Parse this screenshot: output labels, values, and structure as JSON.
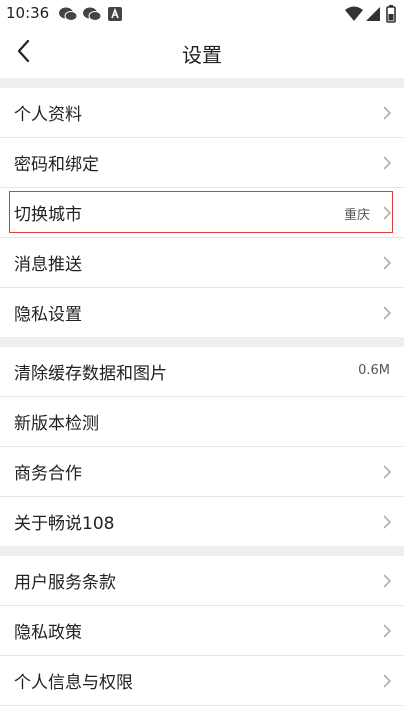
{
  "status_bar": {
    "time": "10:36",
    "notification_icons": [
      "wechat-icon",
      "wechat-icon",
      "app-a-icon"
    ],
    "right_icons": [
      "wifi-icon",
      "signal-icon",
      "battery-icon"
    ]
  },
  "header": {
    "title": "设置",
    "back_icon": "chevron-left-icon"
  },
  "sections": [
    {
      "items": [
        {
          "label": "个人资料",
          "value": "",
          "arrow": true
        },
        {
          "label": "密码和绑定",
          "value": "",
          "arrow": true
        },
        {
          "label": "切换城市",
          "value": "重庆",
          "arrow": true,
          "highlighted": true
        },
        {
          "label": "消息推送",
          "value": "",
          "arrow": true
        },
        {
          "label": "隐私设置",
          "value": "",
          "arrow": true
        }
      ]
    },
    {
      "items": [
        {
          "label": "清除缓存数据和图片",
          "value": "0.6M",
          "arrow": false
        },
        {
          "label": "新版本检测",
          "value": "",
          "arrow": false
        },
        {
          "label": "商务合作",
          "value": "",
          "arrow": true
        },
        {
          "label": "关于畅说108",
          "value": "",
          "arrow": true
        }
      ]
    },
    {
      "items": [
        {
          "label": "用户服务条款",
          "value": "",
          "arrow": true
        },
        {
          "label": "隐私政策",
          "value": "",
          "arrow": true
        },
        {
          "label": "个人信息与权限",
          "value": "",
          "arrow": true
        }
      ]
    }
  ],
  "colors": {
    "background": "#ffffff",
    "section_gap": "#eeeeee",
    "divider": "#e6e6e6",
    "text": "#222222",
    "secondary_text": "#555555",
    "chevron": "#b0b0b0",
    "highlight_border": "#e23b3b"
  }
}
